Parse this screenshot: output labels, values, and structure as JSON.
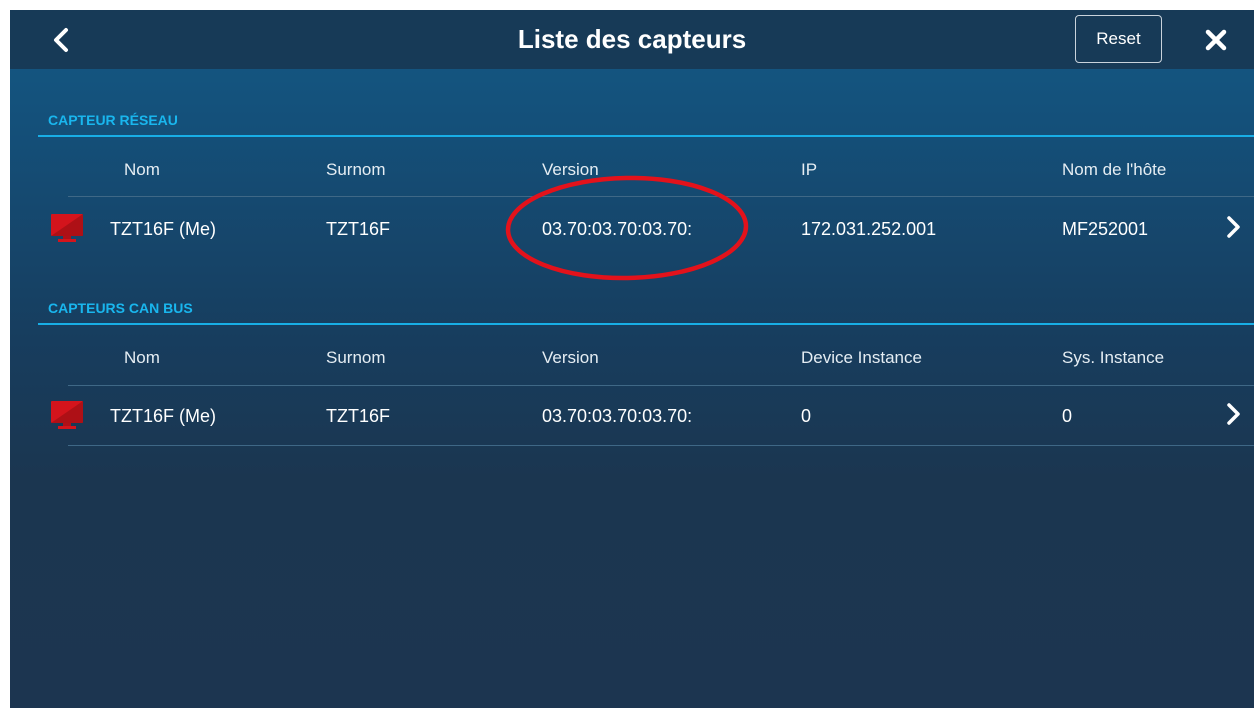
{
  "header": {
    "title": "Liste des capteurs",
    "back_icon": "chevron-left-icon",
    "reset_label": "Reset",
    "close_icon": "close-icon"
  },
  "network_section": {
    "title": "CAPTEUR RÉSEAU",
    "columns": [
      "Nom",
      "Surnom",
      "Version",
      "IP",
      "Nom de l'hôte"
    ],
    "rows": [
      {
        "icon": "monitor-icon",
        "nom": "TZT16F (Me)",
        "surnom": "TZT16F",
        "version": "03.70:03.70:03.70:",
        "ip": "172.031.252.001",
        "hostname": "MF252001"
      }
    ]
  },
  "canbus_section": {
    "title": "CAPTEURS CAN BUS",
    "columns": [
      "Nom",
      "Surnom",
      "Version",
      "Device Instance",
      "Sys. Instance"
    ],
    "rows": [
      {
        "icon": "monitor-icon",
        "nom": "TZT16F (Me)",
        "surnom": "TZT16F",
        "version": "03.70:03.70:03.70:",
        "device_instance": "0",
        "sys_instance": "0"
      }
    ]
  },
  "colors": {
    "accent": "#18aee6",
    "annotation": "#e3121b",
    "header_bg": "#173a57",
    "device_icon": "#d4141c"
  }
}
